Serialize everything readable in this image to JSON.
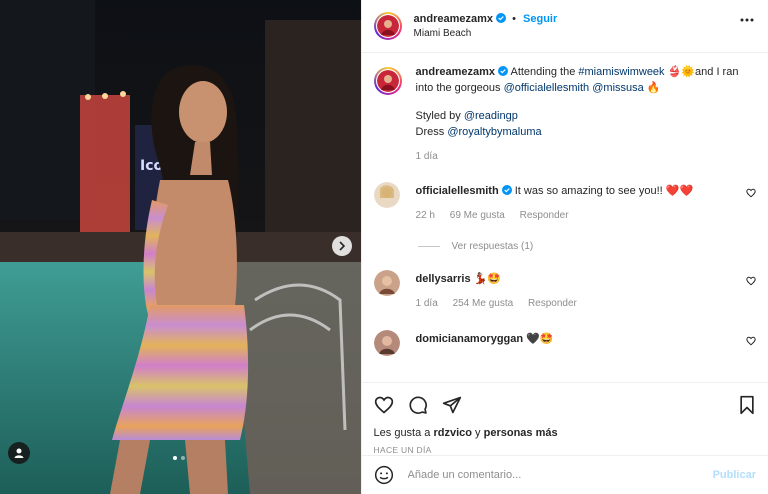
{
  "post": {
    "author": "andreamezamx",
    "follow_label": "Seguir",
    "location": "Miami Beach",
    "caption_prefix": "Attending the ",
    "caption_hashtag": "#miamiswimweek",
    "caption_emoji1": "👙🌞",
    "caption_mid": "and I ran into the gorgeous ",
    "caption_mention1": "@officialellesmith",
    "caption_mention2": "@missusa",
    "caption_emoji2": "🔥",
    "styled_by_label": "Styled by ",
    "styled_by": "@readingp",
    "dress_label": "Dress ",
    "dress_by": "@royaltybymaluma",
    "age": "1 día"
  },
  "comments": [
    {
      "user": "officialellesmith",
      "verified": true,
      "text": "It was so amazing to see you!! ❤️❤️",
      "age": "22 h",
      "likes": "69 Me gusta",
      "reply": "Responder",
      "view_replies": "Ver respuestas (1)"
    },
    {
      "user": "dellysarris",
      "verified": false,
      "text": "💃🏽🤩",
      "age": "1 día",
      "likes": "254 Me gusta",
      "reply": "Responder"
    },
    {
      "user": "domicianamoryggan",
      "verified": false,
      "text": "🖤🤩"
    }
  ],
  "likes_line": {
    "prefix": "Les gusta a ",
    "user": "rdzvico",
    "connector": " y ",
    "rest": "personas más"
  },
  "timestamp": "HACE UN DÍA",
  "compose": {
    "placeholder": "Añade un comentario...",
    "publish": "Publicar"
  },
  "carousel": {
    "current": 1,
    "total": 2
  },
  "colors": {
    "accent": "#0095f6",
    "publish_disabled": "#b2dffc",
    "link": "#00376b"
  }
}
